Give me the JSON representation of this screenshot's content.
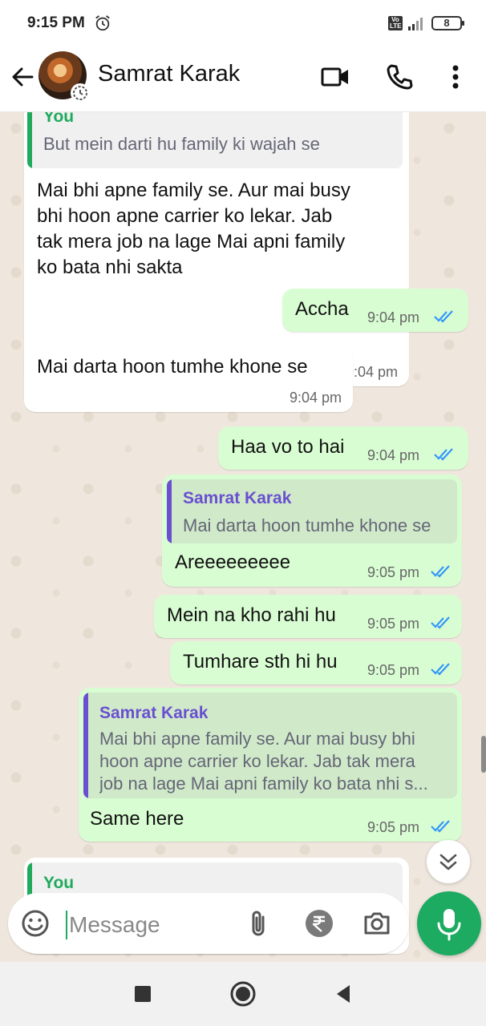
{
  "status_bar": {
    "time": "9:15 PM",
    "network_badge": "Vo LTE",
    "battery": "8"
  },
  "header": {
    "contact_name": "Samrat Karak"
  },
  "messages": [
    {
      "direction": "incoming",
      "quote": {
        "author": "You",
        "text": "But mein darti hu family ki wajah se"
      },
      "text_lines": [
        "Mai bhi apne family se. Aur mai busy",
        "bhi hoon apne carrier ko lekar.  Jab",
        "tak mera job na lage Mai apni family",
        "ko bata nhi sakta"
      ],
      "time": "9:04 pm"
    },
    {
      "direction": "outgoing",
      "text": "Accha",
      "time": "9:04 pm"
    },
    {
      "direction": "incoming",
      "text": "Mai darta hoon tumhe khone se",
      "time": "9:04 pm"
    },
    {
      "direction": "outgoing",
      "text": "Haa vo to hai",
      "time": "9:04 pm"
    },
    {
      "direction": "outgoing",
      "quote": {
        "author": "Samrat Karak",
        "text": "Mai darta hoon tumhe khone se"
      },
      "text": "Areeeeeeeee",
      "time": "9:05 pm"
    },
    {
      "direction": "outgoing",
      "text": "Mein na kho rahi hu",
      "time": "9:05 pm"
    },
    {
      "direction": "outgoing",
      "text": "Tumhare sth hi hu",
      "time": "9:05 pm"
    },
    {
      "direction": "outgoing",
      "quote": {
        "author": "Samrat Karak",
        "text_lines": [
          "Mai bhi apne family se. Aur mai busy bhi",
          "hoon apne carrier ko lekar.  Jab tak mera",
          "job na lage Mai apni family ko bata nhi s..."
        ]
      },
      "text": "Same here",
      "time": "9:05 pm"
    },
    {
      "direction": "incoming",
      "quote": {
        "author": "You"
      }
    }
  ],
  "composer": {
    "placeholder": "Message"
  },
  "colors": {
    "outgoing_bubble": "#d9fdd3",
    "incoming_bubble": "#ffffff",
    "accent_green": "#1daa61",
    "quote_you": "#1faa5c",
    "quote_contact": "#6a4fd0",
    "read_ticks": "#3497f9"
  },
  "icons": [
    "back-arrow-icon",
    "video-call-icon",
    "voice-call-icon",
    "more-options-icon",
    "emoji-icon",
    "attach-icon",
    "rupee-icon",
    "camera-icon",
    "mic-icon",
    "scroll-down-icon"
  ]
}
